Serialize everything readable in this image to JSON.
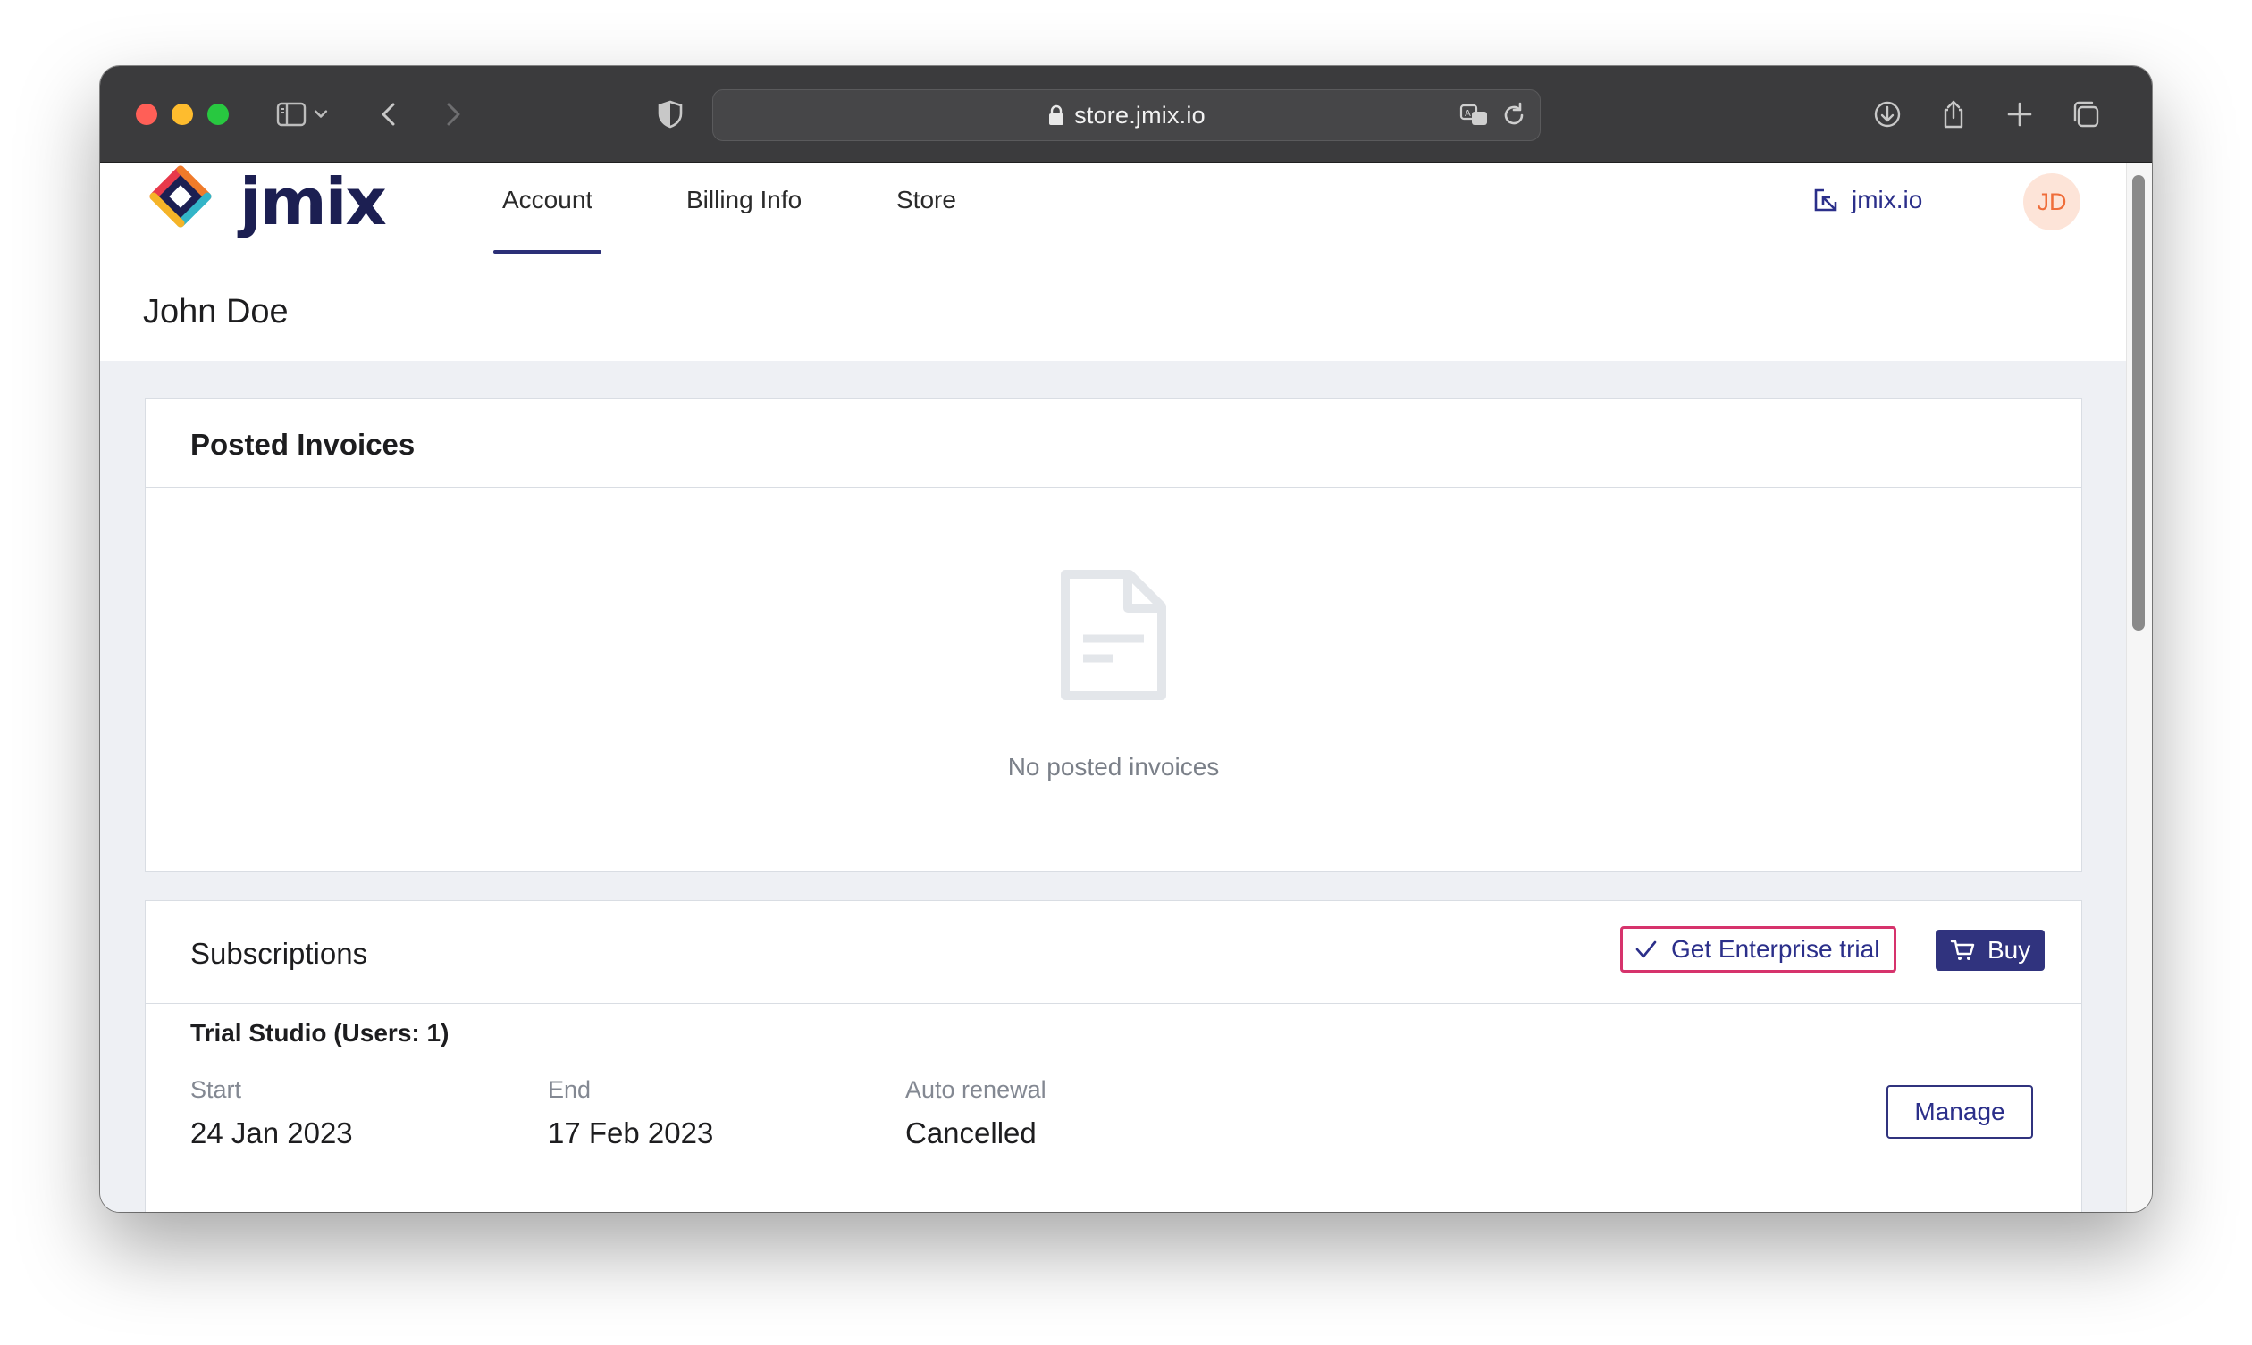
{
  "browser": {
    "url": "store.jmix.io",
    "icons": [
      "sidebar-icon",
      "chevron-down-icon",
      "back-icon",
      "forward-icon",
      "shield-icon",
      "lock-icon",
      "translate-icon",
      "reload-icon",
      "download-icon",
      "share-icon",
      "new-tab-icon",
      "tabs-overview-icon"
    ]
  },
  "header": {
    "logo_text": "jmix",
    "nav": [
      {
        "label": "Account",
        "active": true
      },
      {
        "label": "Billing Info",
        "active": false
      },
      {
        "label": "Store",
        "active": false
      }
    ],
    "external_link": "jmix.io",
    "avatar_initials": "JD"
  },
  "user": {
    "name": "John Doe"
  },
  "invoices": {
    "title": "Posted Invoices",
    "empty_text": "No posted invoices"
  },
  "subscriptions": {
    "title": "Subscriptions",
    "trial_button": "Get Enterprise trial",
    "buy_button": "Buy",
    "item": {
      "name": "Trial Studio (Users: 1)",
      "start_label": "Start",
      "start_value": "24 Jan 2023",
      "end_label": "End",
      "end_value": "17 Feb 2023",
      "renewal_label": "Auto renewal",
      "renewal_value": "Cancelled",
      "manage_button": "Manage"
    }
  },
  "colors": {
    "brand_navy": "#30337e",
    "highlight_pink": "#d6336c",
    "avatar_bg": "#fde4d8",
    "avatar_text": "#ef6d3a"
  }
}
